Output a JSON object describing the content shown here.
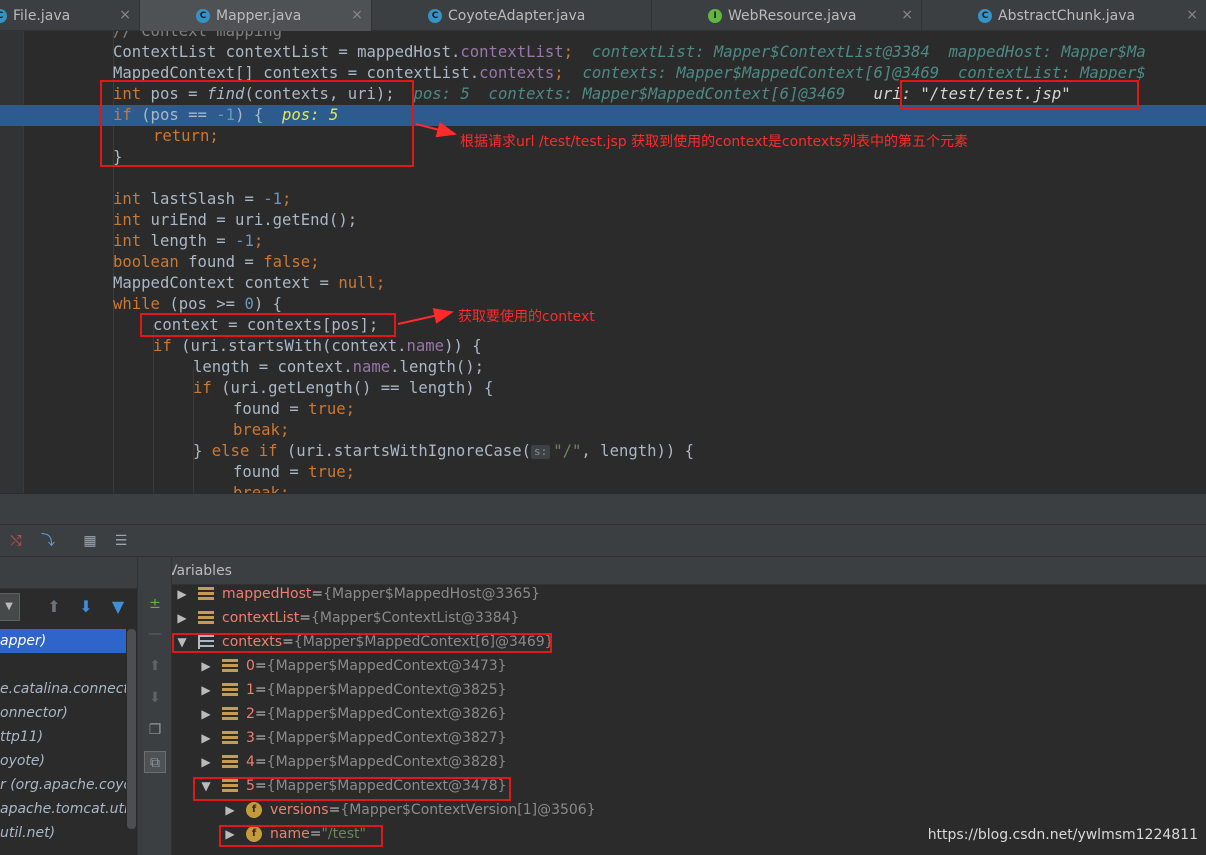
{
  "tabs": [
    {
      "label": "File.java",
      "icon": "",
      "active": false
    },
    {
      "label": "Mapper.java",
      "icon": "C",
      "active": true
    },
    {
      "label": "CoyoteAdapter.java",
      "icon": "C",
      "active": false
    },
    {
      "label": "WebResource.java",
      "icon": "I",
      "active": false
    },
    {
      "label": "AbstractChunk.java",
      "icon": "C",
      "active": false
    }
  ],
  "tab_close_glyph": "×",
  "code": {
    "l0": "// Context mapping",
    "l1_a": "ContextList contextList = mappedHost.",
    "l1_f": "contextList",
    "l1_b": ";",
    "l1_hint": "contextList: Mapper$ContextList@3384  mappedHost: Mapper$Ma",
    "l2_a": "MappedContext[] contexts = contextList.",
    "l2_f": "contexts",
    "l2_b": ";",
    "l2_hint": "contexts: Mapper$MappedContext[6]@3469  contextList: Mapper$",
    "l3_k": "int",
    "l3_a": " pos = ",
    "l3_call": "find",
    "l3_b": "(contexts, uri);",
    "l3_hint": "pos: 5  contexts: Mapper$MappedContext[6]@3469",
    "l3_hint2": "uri: \"/test/test.jsp\"",
    "l4_k": "if",
    "l4_a": " (pos == ",
    "l4_n": "-1",
    "l4_b": ") {",
    "l4_hint": "pos: 5",
    "l5_k": "return",
    "l5_b": ";",
    "l6": "}",
    "l8_k": "int",
    "l8_a": " lastSlash = ",
    "l8_n": "-1",
    "l8_b": ";",
    "l9_k": "int",
    "l9_a": " uriEnd = uri.getEnd();",
    "l10_k": "int",
    "l10_a": " length = ",
    "l10_n": "-1",
    "l10_b": ";",
    "l11_k": "boolean",
    "l11_a": " found = ",
    "l11_v": "false",
    "l11_b": ";",
    "l12_a": "MappedContext context = ",
    "l12_v": "null",
    "l12_b": ";",
    "l13_k": "while",
    "l13_a": " (pos >= ",
    "l13_n": "0",
    "l13_b": ") {",
    "l14": "context = contexts[pos];",
    "l15_k": "if",
    "l15_a": " (uri.startsWith(context.",
    "l15_f": "name",
    "l15_b": ")) {",
    "l16_a": "length = context.",
    "l16_f": "name",
    "l16_b": ".length();",
    "l17_k": "if",
    "l17_a": " (uri.getLength() == length) {",
    "l18_a": "found = ",
    "l18_v": "true",
    "l18_b": ";",
    "l19_k": "break",
    "l19_b": ";",
    "l20_a": "} ",
    "l20_k": "else if",
    "l20_b": " (uri.startsWithIgnoreCase(",
    "l20_chip": "s:",
    "l20_s": "\"/\"",
    "l20_c": ", length)) {",
    "l21_a": "found = ",
    "l21_v": "true",
    "l21_b": ";",
    "l22_k": "break",
    "l22_b": ";"
  },
  "annotations": {
    "a1": "根据请求url  /test/test.jsp 获取到使用的context是contexts列表中的第五个元素",
    "a2": "获取要使用的context"
  },
  "frames": [
    "apper)",
    "e.catalina.connector",
    "onnector)",
    "ttp11)",
    "oyote)",
    "r (org.apache.coyote",
    "apache.tomcat.util.ne",
    "util.net)"
  ],
  "variables_title": "Variables",
  "vars": {
    "v1_name": "mappedHost",
    "v1_eq": " = ",
    "v1_val": "{Mapper$MappedHost@3365}",
    "v2_name": "contextList",
    "v2_eq": " = ",
    "v2_val": "{Mapper$ContextList@3384}",
    "v3_name": "contexts",
    "v3_eq": " = ",
    "v3_val": "{Mapper$MappedContext[6]@3469}",
    "e0_name": "0",
    "e0_val": "{Mapper$MappedContext@3473}",
    "e1_name": "1",
    "e1_val": "{Mapper$MappedContext@3825}",
    "e2_name": "2",
    "e2_val": "{Mapper$MappedContext@3826}",
    "e3_name": "3",
    "e3_val": "{Mapper$MappedContext@3827}",
    "e4_name": "4",
    "e4_val": "{Mapper$MappedContext@3828}",
    "e5_name": "5",
    "e5_val": "{Mapper$MappedContext@3478}",
    "f1_name": "versions",
    "f1_val": "{Mapper$ContextVersion[1]@3506}",
    "f2_name": "name",
    "f2_val": "\"/test\"",
    "eq": " = "
  },
  "watermark": "https://blog.csdn.net/ywlmsm1224811",
  "colors": {
    "exec_line": "#2d5b8e",
    "annotation": "#ff2a2a",
    "keyword": "#cc7832",
    "number": "#6897bb",
    "field": "#9876aa"
  }
}
